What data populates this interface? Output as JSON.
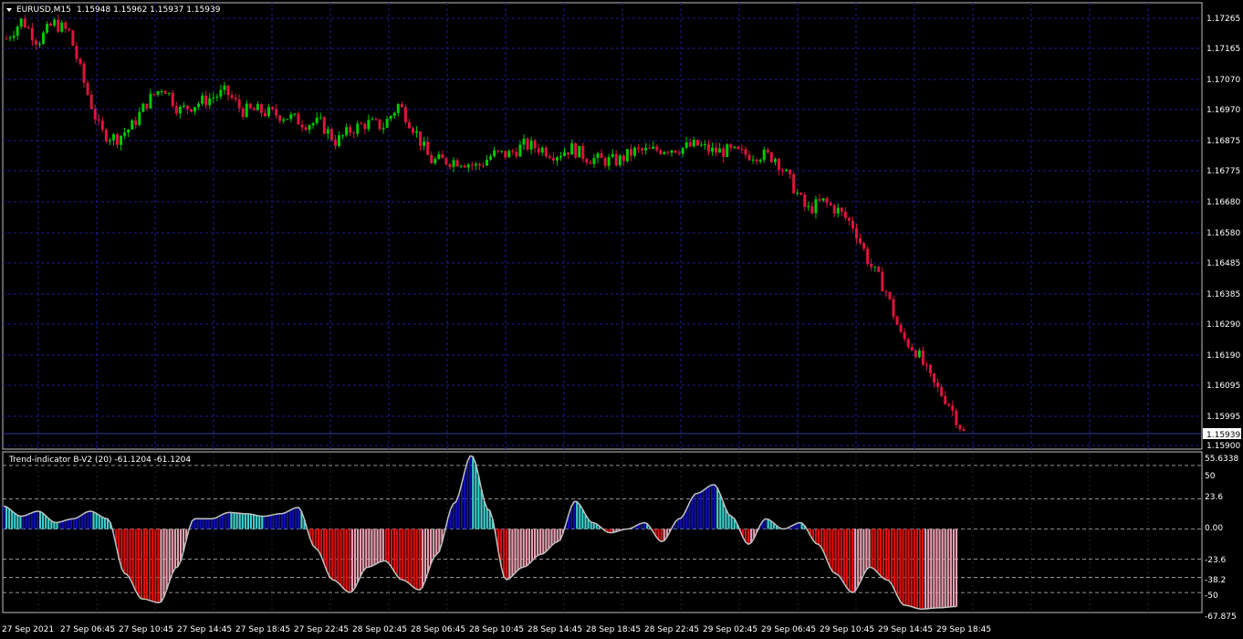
{
  "header": {
    "symbol": "EURUSD,M15",
    "ohlc": "1.15948 1.15962 1.15937 1.15939"
  },
  "price_axis": {
    "labels": [
      "1.17265",
      "1.17165",
      "1.17070",
      "1.16970",
      "1.16875",
      "1.16775",
      "1.16680",
      "1.16580",
      "1.16485",
      "1.16385",
      "1.16290",
      "1.16190",
      "1.16095",
      "1.15995",
      "1.15900"
    ],
    "current": "1.15939"
  },
  "indicator": {
    "title": "Trend-indicator B-V2 (20) -61.1204 -61.1204",
    "axis_labels": [
      "55.6338",
      "50",
      "23.6",
      "0.00",
      "-23.6",
      "-38.2",
      "-50",
      "-67.875"
    ]
  },
  "time_axis": {
    "labels": [
      "27 Sep 2021",
      "27 Sep 06:45",
      "27 Sep 10:45",
      "27 Sep 14:45",
      "27 Sep 18:45",
      "27 Sep 22:45",
      "28 Sep 02:45",
      "28 Sep 06:45",
      "28 Sep 10:45",
      "28 Sep 14:45",
      "28 Sep 18:45",
      "28 Sep 22:45",
      "29 Sep 02:45",
      "29 Sep 06:45",
      "29 Sep 10:45",
      "29 Sep 14:45",
      "29 Sep 18:45"
    ]
  },
  "colors": {
    "background": "#000000",
    "grid": "#1b1b8f",
    "bull": "#00c800",
    "bear": "#dc143c",
    "hist_blue": "#1010b0",
    "hist_cyan": "#40d0d0",
    "hist_red": "#e01010",
    "hist_pink": "#e8a0b0",
    "hist_line": "#c0c0c0"
  },
  "chart_data": {
    "type": "candlestick",
    "symbol": "EURUSD",
    "timeframe": "M15",
    "price_range": [
      1.159,
      1.17265
    ],
    "path_prices": [
      1.172,
      1.1726,
      1.1719,
      1.1725,
      1.1722,
      1.1705,
      1.169,
      1.1688,
      1.1692,
      1.17,
      1.1705,
      1.1697,
      1.1699,
      1.1701,
      1.1703,
      1.1697,
      1.1697,
      1.1696,
      1.1695,
      1.1693,
      1.1693,
      1.1687,
      1.1691,
      1.1693,
      1.1692,
      1.1699,
      1.1691,
      1.1681,
      1.1681,
      1.1681,
      1.1679,
      1.1683,
      1.1683,
      1.1686,
      1.1685,
      1.1683,
      1.1685,
      1.1682,
      1.1681,
      1.1681,
      1.1684,
      1.1684,
      1.1685,
      1.1685,
      1.1686,
      1.1684,
      1.1684,
      1.1683,
      1.1683,
      1.1682,
      1.1674,
      1.1665,
      1.1668,
      1.1665,
      1.166,
      1.1648,
      1.164,
      1.1625,
      1.162,
      1.161,
      1.1604,
      1.1594
    ],
    "indicator": {
      "name": "Trend-indicator B-V2 (20)",
      "value": -61.1204,
      "range": [
        -67.875,
        55.6338
      ],
      "levels": [
        50,
        23.6,
        0,
        -23.6,
        -38.2,
        -50
      ],
      "profile": [
        18,
        10,
        14,
        5,
        8,
        14,
        8,
        -35,
        -55,
        -58,
        -30,
        8,
        8,
        13,
        12,
        10,
        12,
        17,
        -15,
        -40,
        -50,
        -30,
        -25,
        -40,
        -48,
        -20,
        20,
        58,
        15,
        -40,
        -30,
        -20,
        -10,
        22,
        5,
        -3,
        0,
        5,
        -10,
        8,
        28,
        35,
        10,
        -12,
        8,
        0,
        5,
        -12,
        -35,
        -50,
        -30,
        -40,
        -60,
        -63,
        -62,
        -61
      ]
    }
  }
}
